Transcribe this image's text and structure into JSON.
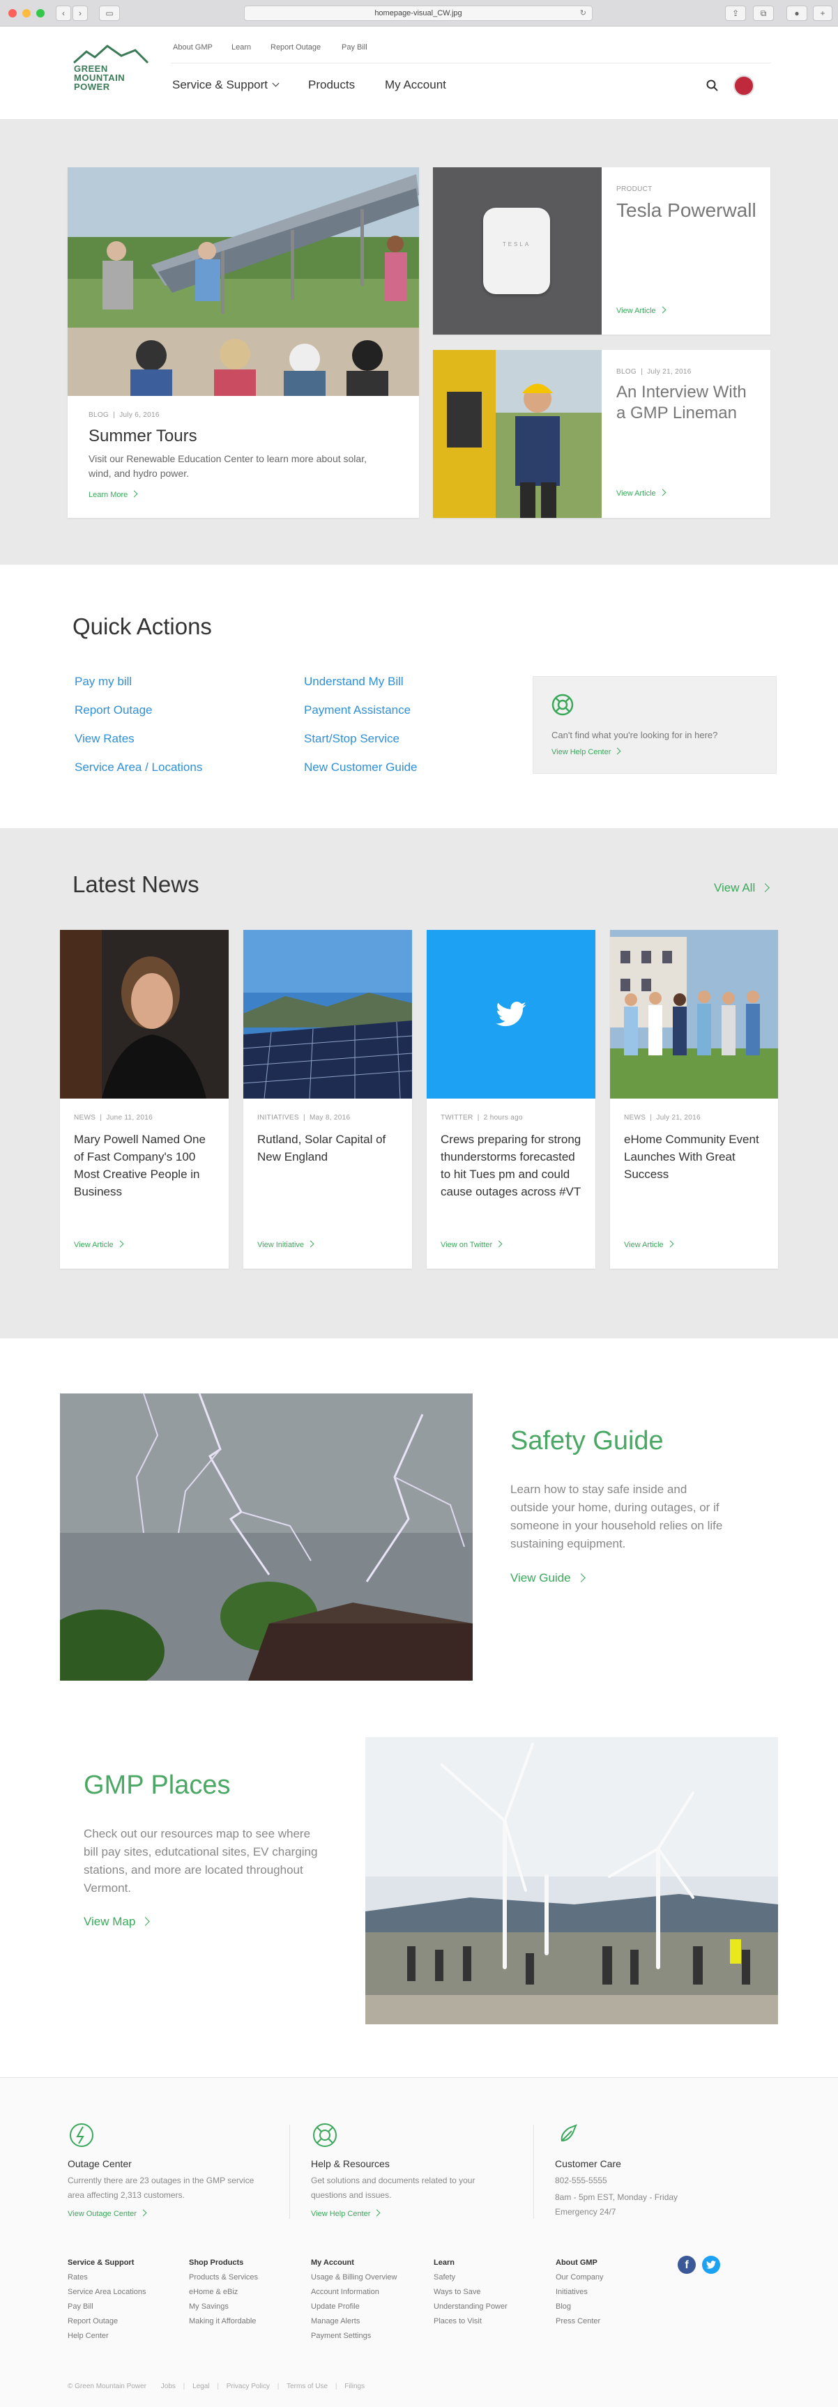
{
  "browser": {
    "url": "homepage-visual_CW.jpg"
  },
  "header": {
    "logo_line1": "GREEN",
    "logo_line2": "MOUNTAIN",
    "logo_line3": "POWER",
    "util_nav": [
      "About GMP",
      "Learn",
      "Report Outage",
      "Pay Bill"
    ],
    "main_nav": [
      "Service & Support",
      "Products",
      "My Account"
    ]
  },
  "featured": {
    "main": {
      "meta_type": "BLOG",
      "meta_date": "July 6, 2016",
      "title": "Summer Tours",
      "desc": "Visit our Renewable Education Center to learn more about solar, wind, and hydro power.",
      "link": "Learn More"
    },
    "side1": {
      "meta": "PRODUCT",
      "title": "Tesla Powerwall",
      "link": "View Article",
      "product_label": "TESLA"
    },
    "side2": {
      "meta_type": "BLOG",
      "meta_date": "July 21, 2016",
      "title": "An Interview With a GMP Lineman",
      "link": "View Article"
    }
  },
  "quick_actions": {
    "title": "Quick Actions",
    "col1": [
      "Pay my bill",
      "Report Outage",
      "View Rates",
      "Service Area / Locations"
    ],
    "col2": [
      "Understand My Bill",
      "Payment Assistance",
      "Start/Stop Service",
      "New Customer Guide"
    ],
    "help_text": "Can't find what you're looking for in here?",
    "help_link": "View Help Center"
  },
  "news": {
    "title": "Latest News",
    "view_all": "View All",
    "items": [
      {
        "type": "NEWS",
        "date": "June 11, 2016",
        "title": "Mary Powell Named One of Fast Company's 100 Most Creative People in Business",
        "link": "View Article"
      },
      {
        "type": "INITIATIVES",
        "date": "May 8, 2016",
        "title": "Rutland, Solar Capital of New England",
        "link": "View Initiative"
      },
      {
        "type": "TWITTER",
        "date": "2 hours ago",
        "title": "Crews preparing for strong thunderstorms forecasted to hit Tues pm and could cause outages across #VT",
        "link": "View on Twitter"
      },
      {
        "type": "NEWS",
        "date": "July 21, 2016",
        "title": "eHome Community Event Launches With Great Success",
        "link": "View Article"
      }
    ]
  },
  "safety": {
    "title": "Safety Guide",
    "desc": "Learn how to stay safe inside and outside your home, during outages, or if someone in your household relies on life sustaining equipment.",
    "link": "View Guide"
  },
  "places": {
    "title": "GMP Places",
    "desc": "Check out our resources map to see where bill pay sites, edutcational sites, EV charging stations, and more are located throughout Vermont.",
    "link": "View Map"
  },
  "footer": {
    "outage": {
      "title": "Outage Center",
      "desc": "Currently there are 23 outages in the GMP service area affecting 2,313 customers.",
      "link": "View Outage Center"
    },
    "help": {
      "title": "Help & Resources",
      "desc": "Get solutions and documents related to your questions and issues.",
      "link": "View Help Center"
    },
    "care": {
      "title": "Customer Care",
      "phone": "802-555-5555",
      "hours": "8am - 5pm EST, Monday - Friday",
      "emergency": "Emergency 24/7"
    },
    "columns": [
      {
        "heading": "Service & Support",
        "links": [
          "Rates",
          "Service Area Locations",
          "Pay Bill",
          "Report Outage",
          "Help Center"
        ]
      },
      {
        "heading": "Shop Products",
        "links": [
          "Products & Services",
          "eHome & eBiz",
          "My Savings",
          "Making it Affordable"
        ]
      },
      {
        "heading": "My Account",
        "links": [
          "Usage & Billing Overview",
          "Account Information",
          "Update Profile",
          "Manage Alerts",
          "Payment Settings"
        ]
      },
      {
        "heading": "Learn",
        "links": [
          "Safety",
          "Ways to Save",
          "Understanding Power",
          "Places to Visit"
        ]
      },
      {
        "heading": "About GMP",
        "links": [
          "Our Company",
          "Initiatives",
          "Blog",
          "Press Center"
        ]
      }
    ],
    "bottom": [
      "© Green Mountain Power",
      "Jobs",
      "Legal",
      "Privacy Policy",
      "Terms of Use",
      "Filings"
    ]
  }
}
